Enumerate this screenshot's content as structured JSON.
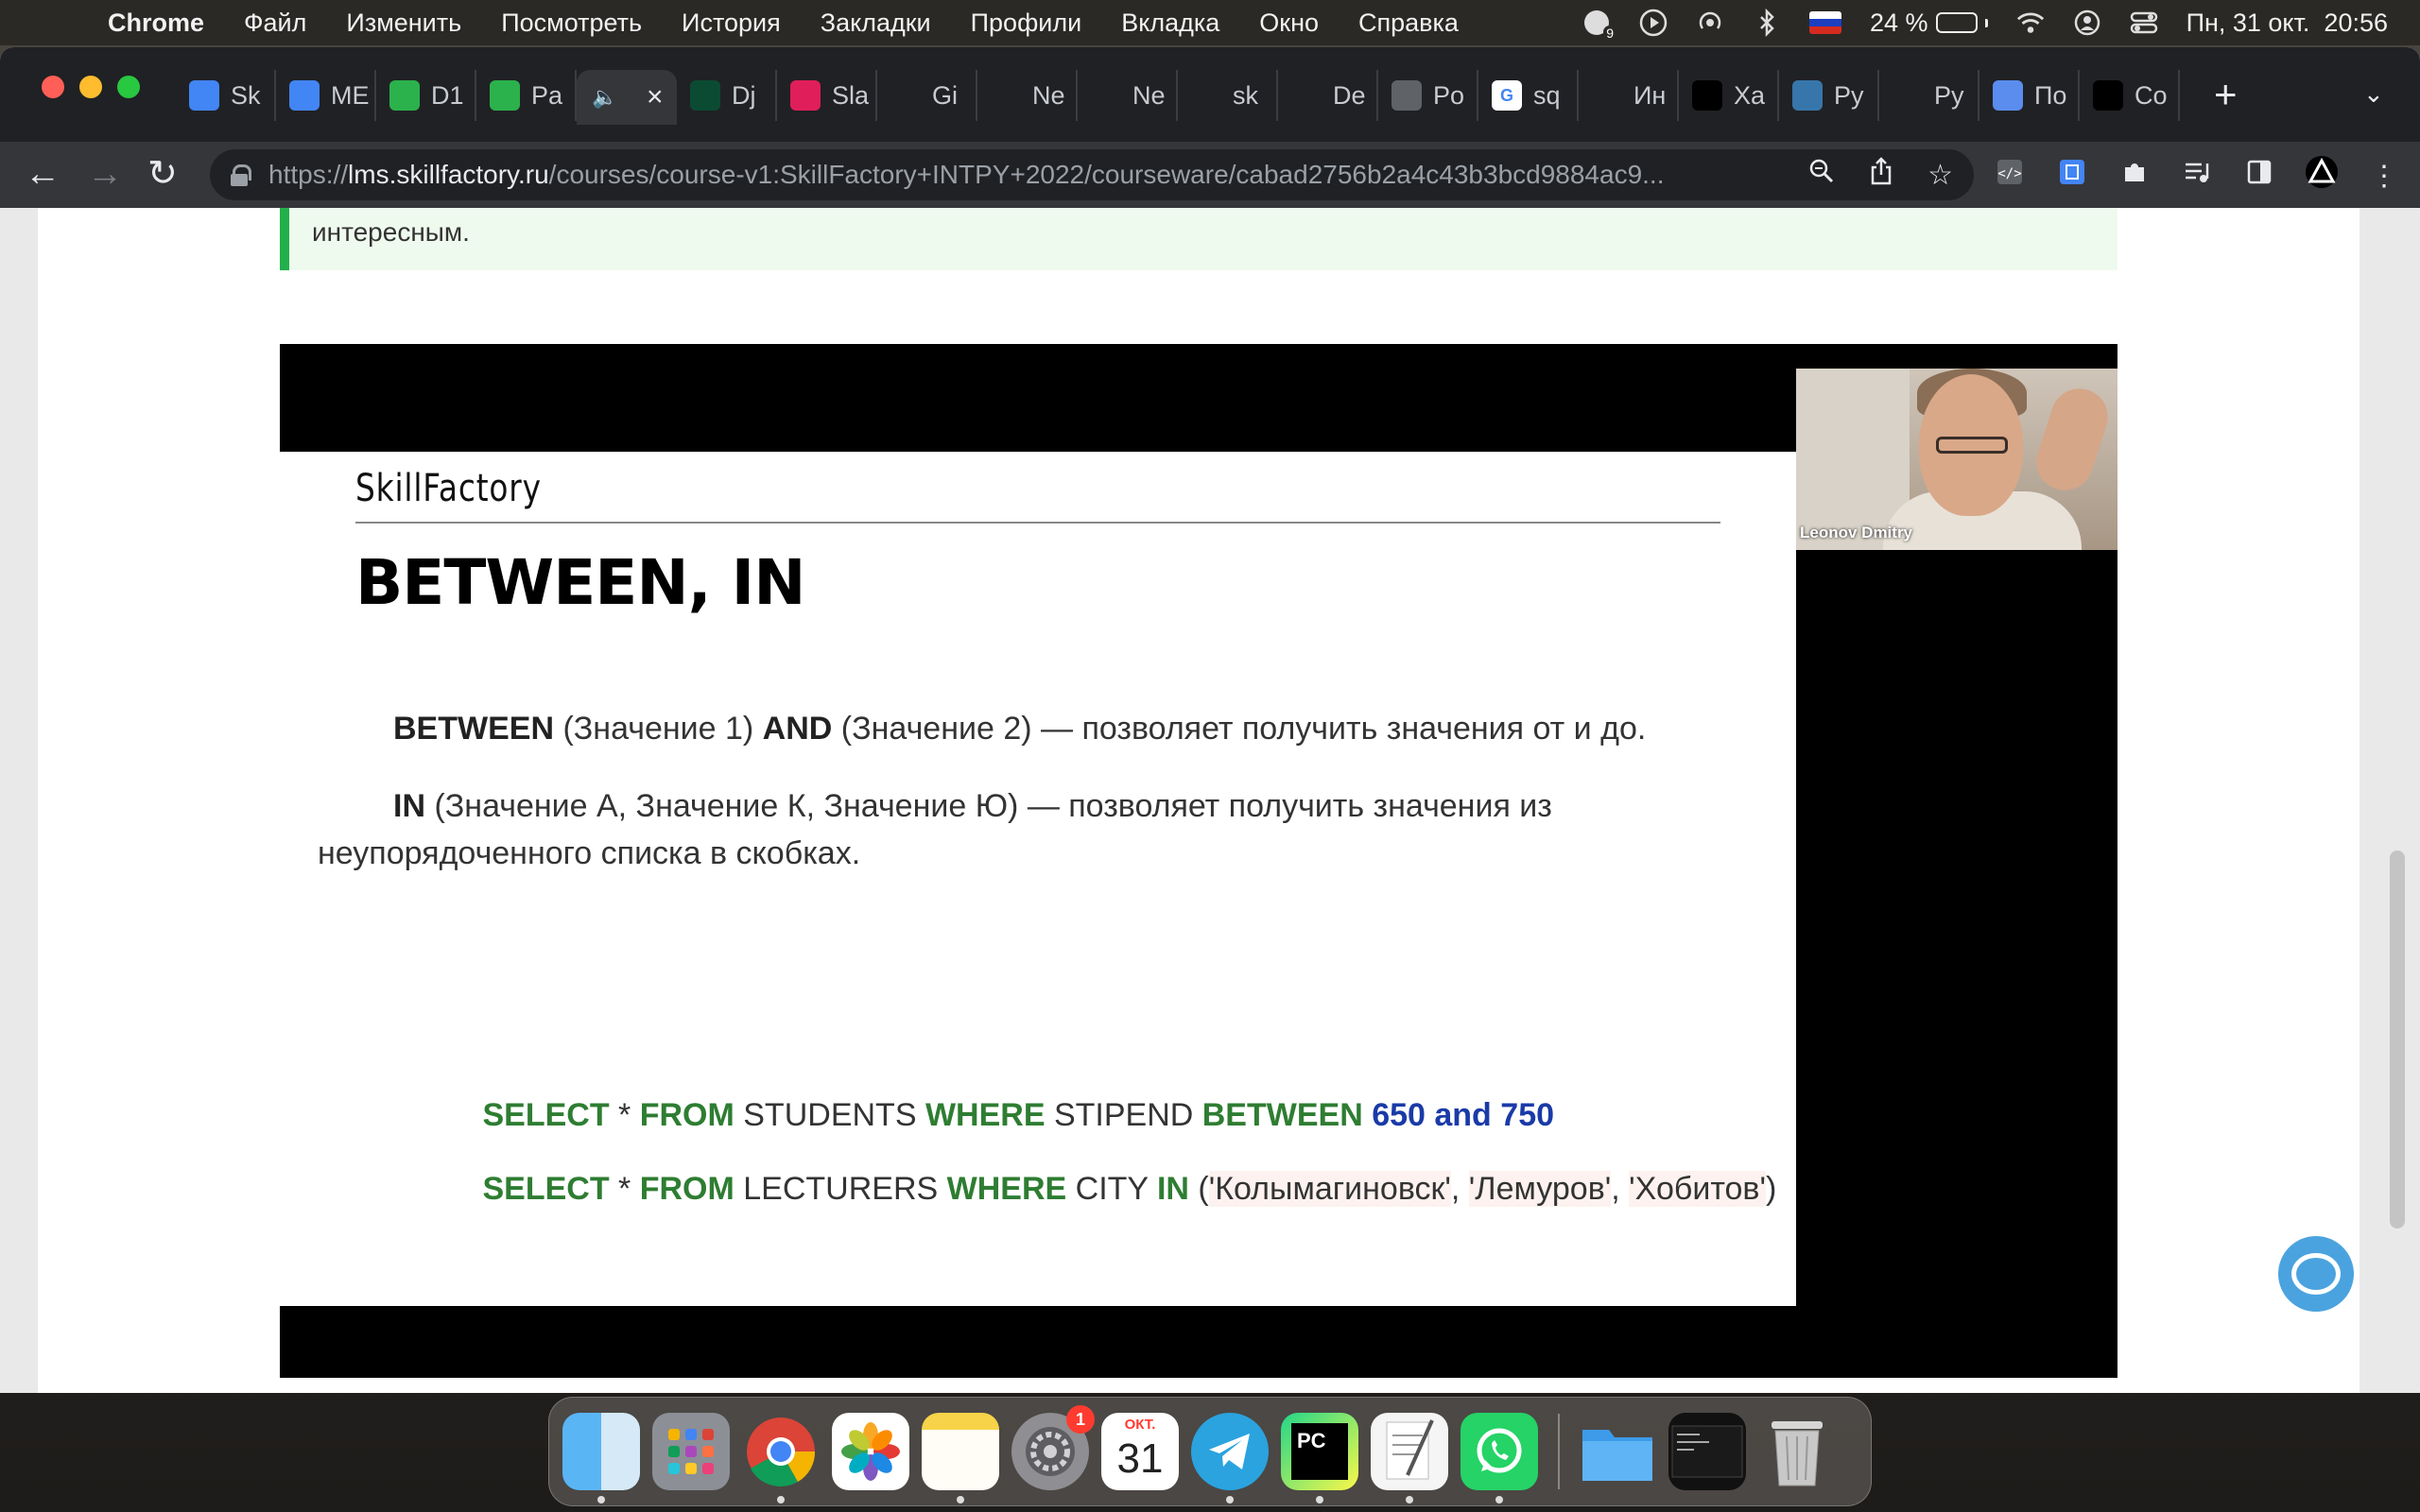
{
  "menubar": {
    "app": "Chrome",
    "items": [
      "Файл",
      "Изменить",
      "Посмотреть",
      "История",
      "Закладки",
      "Профили",
      "Вкладка",
      "Окно",
      "Справка"
    ],
    "notification_count": "9",
    "battery": "24 %",
    "battery_level": 0.24,
    "datetime": "Пн, 31 окт.  20:56"
  },
  "tabs": [
    {
      "label": "Sk",
      "icon": "google-docs-icon",
      "color": "#4285f4"
    },
    {
      "label": "ME",
      "icon": "google-docs-icon",
      "color": "#4285f4"
    },
    {
      "label": "D1",
      "icon": "skillfactory-icon",
      "color": "#2bb24c"
    },
    {
      "label": "Pa",
      "icon": "skillfactory-icon",
      "color": "#2bb24c"
    },
    {
      "label": "",
      "icon": "speaker-icon",
      "color": "#35363a"
    },
    {
      "label": "Dj",
      "icon": "django-icon",
      "color": "#0c4b33"
    },
    {
      "label": "Sla",
      "icon": "slack-icon",
      "color": "#e01e5a"
    },
    {
      "label": "Gi",
      "icon": "github-icon",
      "color": "#202124"
    },
    {
      "label": "Ne",
      "icon": "github-icon",
      "color": "#202124"
    },
    {
      "label": "Ne",
      "icon": "github-icon",
      "color": "#202124"
    },
    {
      "label": "sk",
      "icon": "github-icon",
      "color": "#202124"
    },
    {
      "label": "De",
      "icon": "pen-icon",
      "color": "#202124"
    },
    {
      "label": "Po",
      "icon": "globe-icon",
      "color": "#5f6368"
    },
    {
      "label": "sq",
      "icon": "google-icon",
      "color": "#ffffff"
    },
    {
      "label": "Ин",
      "icon": "search-red-icon",
      "color": "#202124"
    },
    {
      "label": "Ха",
      "icon": "hexlet-icon",
      "color": "#000000"
    },
    {
      "label": "Py",
      "icon": "python-icon",
      "color": "#3776ab"
    },
    {
      "label": "Py",
      "icon": "m-icon",
      "color": "#202124"
    },
    {
      "label": "По",
      "icon": "compass-icon",
      "color": "#5b8def"
    },
    {
      "label": "Co",
      "icon": "jetbrains-icon",
      "color": "#000000"
    }
  ],
  "omnibox": {
    "scheme": "https://",
    "host": "lms.skillfactory.ru",
    "path": "/courses/course-v1:SkillFactory+INTPY+2022/courseware/cabad2756b2a4c43b3bcd9884ac9..."
  },
  "page": {
    "note_text": "интересным."
  },
  "slide": {
    "brand": "SkillFactory",
    "title": "BETWEEN, IN",
    "between_kw": "BETWEEN",
    "between_v1": " (Значение 1) ",
    "between_and": "AND",
    "between_rest": " (Значение 2) — позволяет получить значения от и до.",
    "in_kw": "IN",
    "in_rest": " (Значение А, Значение К, Значение Ю) — позволяет получить значения из",
    "in_rest2": "неупорядоченного списка в скобках.",
    "q1": {
      "select": "SELECT",
      "star": " * ",
      "from": "FROM",
      "table": " STUDENTS ",
      "where": "WHERE",
      "col": " STIPEND ",
      "between": "BETWEEN",
      "v1": " 650",
      "and": " and",
      "v2": " 750"
    },
    "q2": {
      "select": "SELECT",
      "star": " * ",
      "from": "FROM",
      "table": " LECTURERS ",
      "where": "WHERE",
      "col": " CITY ",
      "in": "IN",
      "open": " (",
      "s1": "'Колымагиновск'",
      "c1": ", ",
      "s2": "'Лемуров'",
      "c2": ", ",
      "s3": "'Хобитов'",
      "close": ")"
    },
    "cam_name": "Leonov Dmitry"
  },
  "dock": {
    "calendar_month": "ОКТ.",
    "calendar_day": "31",
    "settings_badge": "1",
    "pycharm_label": "PC"
  }
}
